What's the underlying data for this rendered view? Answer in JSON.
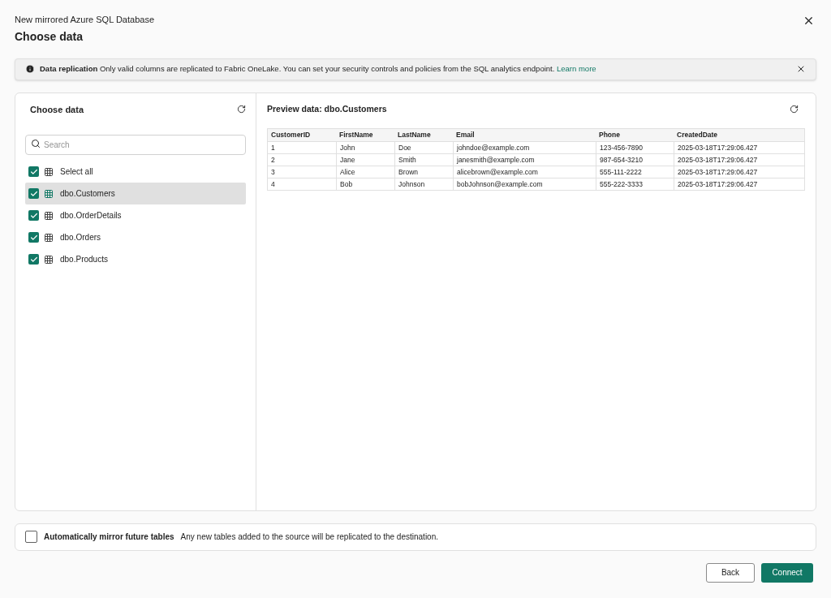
{
  "header": {
    "subtitle": "New mirrored Azure SQL Database",
    "title": "Choose data"
  },
  "banner": {
    "title": "Data replication",
    "message": "Only valid columns are replicated to Fabric OneLake. You can set your security controls and policies from the SQL analytics endpoint.",
    "link": "Learn more"
  },
  "left_panel": {
    "title": "Choose data",
    "search": {
      "placeholder": "Search"
    },
    "items": [
      {
        "label": "Select all",
        "checked": true,
        "selected": false
      },
      {
        "label": "dbo.Customers",
        "checked": true,
        "selected": true
      },
      {
        "label": "dbo.OrderDetails",
        "checked": true,
        "selected": false
      },
      {
        "label": "dbo.Orders",
        "checked": true,
        "selected": false
      },
      {
        "label": "dbo.Products",
        "checked": true,
        "selected": false
      }
    ]
  },
  "preview": {
    "title": "Preview data: dbo.Customers",
    "table": {
      "columns": [
        "CustomerID",
        "FirstName",
        "LastName",
        "Email",
        "Phone",
        "CreatedDate"
      ],
      "rows": [
        [
          "1",
          "John",
          "Doe",
          "johndoe@example.com",
          "123-456-7890",
          "2025-03-18T17:29:06.427"
        ],
        [
          "2",
          "Jane",
          "Smith",
          "janesmith@example.com",
          "987-654-3210",
          "2025-03-18T17:29:06.427"
        ],
        [
          "3",
          "Alice",
          "Brown",
          "alicebrown@example.com",
          "555-111-2222",
          "2025-03-18T17:29:06.427"
        ],
        [
          "4",
          "Bob",
          "Johnson",
          "bobJohnson@example.com",
          "555-222-3333",
          "2025-03-18T17:29:06.427"
        ]
      ]
    }
  },
  "auto_mirror": {
    "label": "Automatically mirror future tables",
    "description": "Any new tables added to the source will be replicated to the destination.",
    "checked": false
  },
  "buttons": [
    {
      "label": "Back",
      "kind": "secondary"
    },
    {
      "label": "Connect",
      "kind": "primary"
    }
  ]
}
